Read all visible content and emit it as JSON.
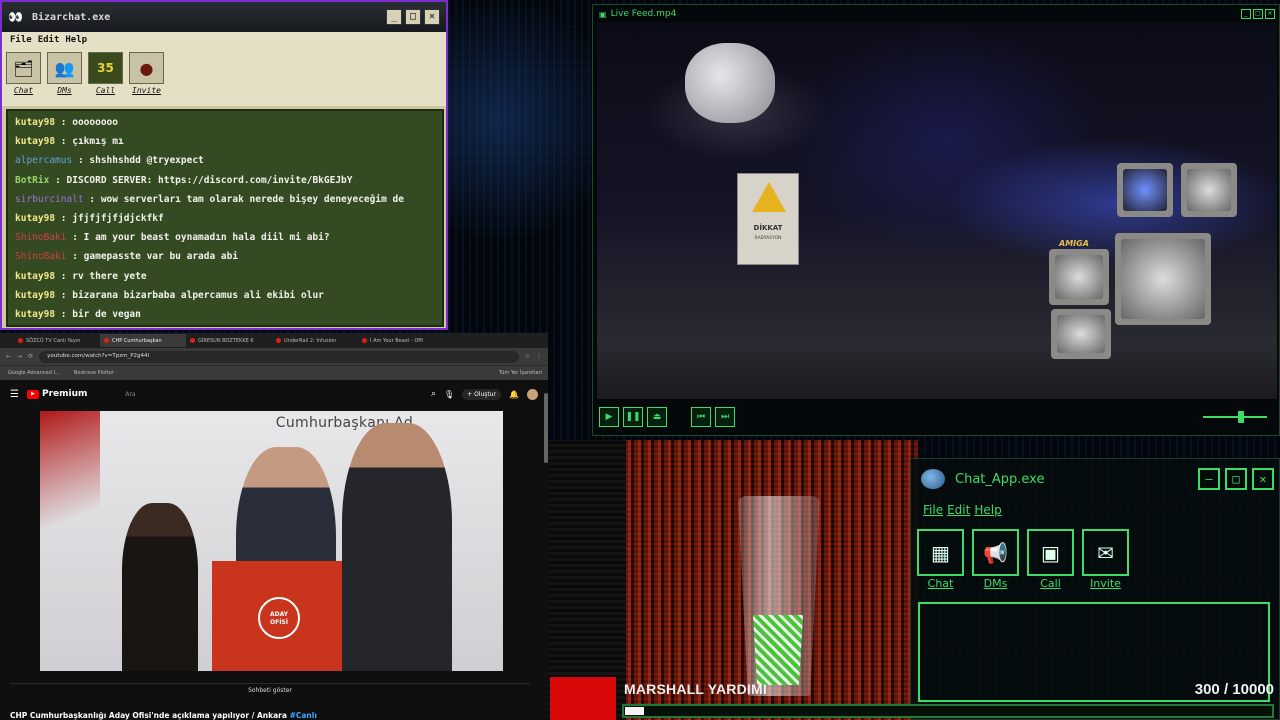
{
  "bizarchat": {
    "title": "Bizarchat.exe",
    "menu": [
      "File",
      "Edit",
      "Help"
    ],
    "window_buttons": [
      "_",
      "□",
      "✕"
    ],
    "tools": [
      {
        "label": "Chat",
        "icon": "chat-icon",
        "glyph": "🗂"
      },
      {
        "label": "DMs",
        "icon": "dms-icon",
        "glyph": "👥"
      },
      {
        "label": "Call",
        "icon": "call-icon",
        "glyph": "35"
      },
      {
        "label": "Invite",
        "icon": "invite-icon",
        "glyph": "●"
      }
    ],
    "messages": [
      {
        "user": "kutay98",
        "text": ": oooooooo",
        "color": "u"
      },
      {
        "user": "kutay98",
        "text": ": çıkmış mı",
        "color": "u"
      },
      {
        "user": "alpercamus",
        "text": ": shshhshdd @tryexpect",
        "color": "u c2"
      },
      {
        "user": "BotRix",
        "text": ": DISCORD SERVER: https://discord.com/invite/BkGEJbY",
        "color": "u c3"
      },
      {
        "user": "sirburcinalt",
        "text": ": wow serverları tam olarak nerede bişey deneyeceğim de",
        "color": "u c4"
      },
      {
        "user": "kutay98",
        "text": ": jfjfjfjfjdjckfkf",
        "color": "u"
      },
      {
        "user": "ShinoBaki",
        "text": ": I am your beast oynamadın hala diil mi abi?",
        "color": "u c5"
      },
      {
        "user": "ShinoBaki",
        "text": ": gamepasste var bu arada abi",
        "color": "u c5"
      },
      {
        "user": "kutay98",
        "text": ": rv there yete",
        "color": "u"
      },
      {
        "user": "kutay98",
        "text": ": bizarana bizarbaba alpercamus ali ekibi olur",
        "color": "u"
      },
      {
        "user": "kutay98",
        "text": ": bir de vegan",
        "color": "u"
      }
    ]
  },
  "browser": {
    "tabs": [
      {
        "label": "SÖZCÜ TV Canlı Yayın",
        "active": false
      },
      {
        "label": "CHP Cumhurbaşkan",
        "active": true
      },
      {
        "label": "GİRESUN BOZTEKKE K",
        "active": false
      },
      {
        "label": "UnderRail 2: Infusion",
        "active": false
      },
      {
        "label": "I Am Your Beast - Offi",
        "active": false
      }
    ],
    "url": "youtube.com/watch?v=Tpzm_P2g44I",
    "bookmarks": [
      "Google Advanced I...",
      "Nostrase Plotter"
    ],
    "bookmarks_right": "Tüm Yer İşaretleri",
    "yt": {
      "brand": "Premium",
      "search_placeholder": "Ara",
      "create_label": "+ Oluştur",
      "video_banner": "Cumhurbaşkanı Ad",
      "watermark": "anka",
      "podium_text": "ADAY OFİSİ",
      "show_chat": "Sohbeti göster",
      "caption": "CHP Cumhurbaşkanlığı Aday Ofisi'nde açıklama yapılıyor / Ankara ",
      "caption_tag": "#Canlı"
    }
  },
  "live_feed": {
    "title": "Live Feed.mp4",
    "sign_title": "DİKKAT",
    "sign_sub": "RADYASYON",
    "amiga": "AMIGA",
    "controls": [
      "▶",
      "❚❚",
      "⏏",
      "⏮",
      "⏭"
    ],
    "volume": 0.6
  },
  "chat_app": {
    "title": "Chat_App.exe",
    "window_buttons": [
      "—",
      "□",
      "✕"
    ],
    "menu": [
      "File",
      "Edit",
      "Help"
    ],
    "tools": [
      {
        "label": "Chat",
        "icon": "chat-icon",
        "glyph": "▦"
      },
      {
        "label": "DMs",
        "icon": "megaphone-icon",
        "glyph": "📢"
      },
      {
        "label": "Call",
        "icon": "call-icon",
        "glyph": "▣"
      },
      {
        "label": "Invite",
        "icon": "invite-icon",
        "glyph": "✉"
      }
    ]
  },
  "goal": {
    "name": "MARSHALL YARDIMI",
    "current": "300",
    "target": "/ 10000",
    "progress": 0.03
  }
}
